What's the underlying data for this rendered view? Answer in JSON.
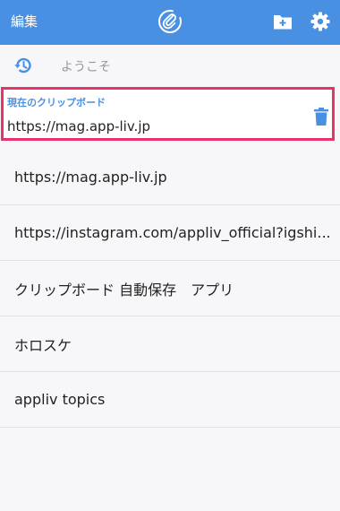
{
  "header": {
    "edit_label": "編集",
    "logo_icon": "paperclip-circle-icon",
    "folder_icon": "folder-add-icon",
    "settings_icon": "gear-icon",
    "background_color": "#4a90e2"
  },
  "welcome": {
    "icon": "history-icon",
    "text": "ようこそ"
  },
  "current_clipboard": {
    "label": "現在のクリップボード",
    "value": "https://mag.app-liv.jp",
    "delete_icon": "trash-icon",
    "highlight_color": "#e8336a"
  },
  "clips": [
    {
      "text": "https://mag.app-liv.jp"
    },
    {
      "text": "https://instagram.com/appliv_official?igshi..."
    },
    {
      "text": "クリップボード 自動保存　アプリ"
    },
    {
      "text": "ホロスケ"
    },
    {
      "text": "appliv topics"
    }
  ]
}
